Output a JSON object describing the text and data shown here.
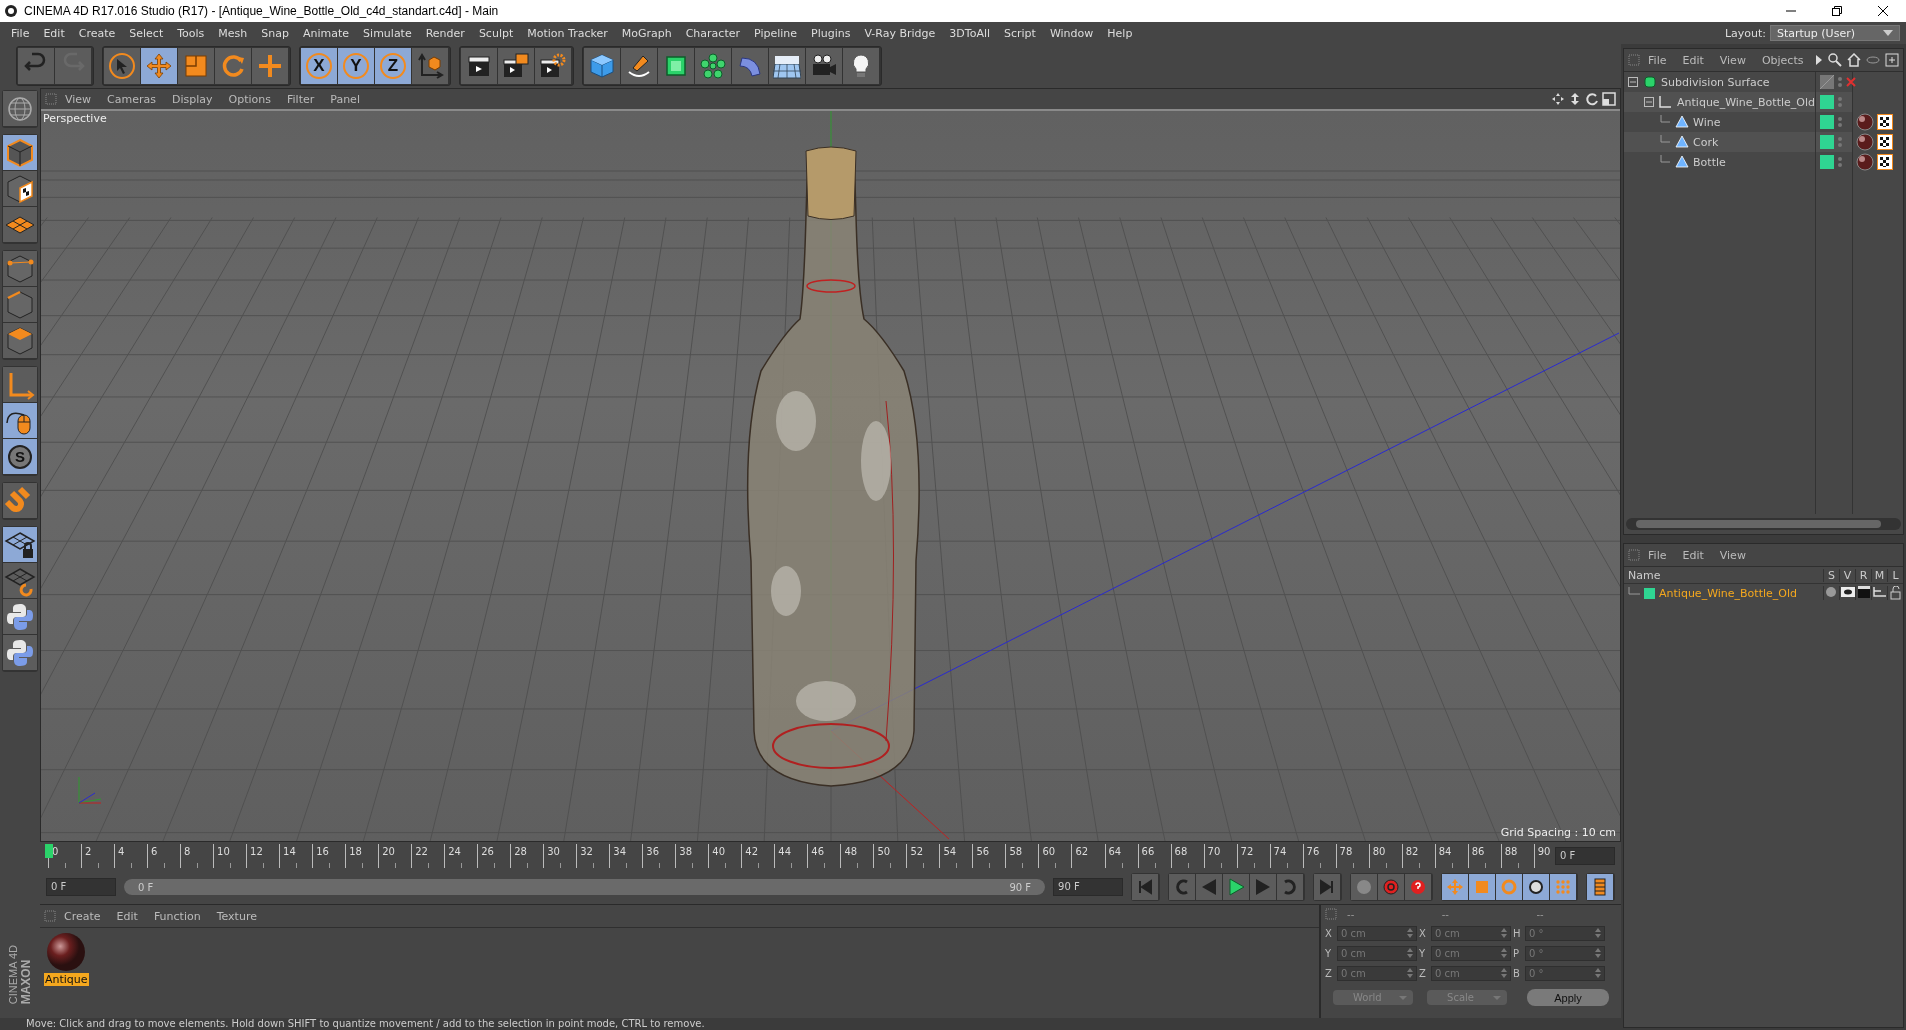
{
  "window": {
    "title": "CINEMA 4D R17.016 Studio (R17) - [Antique_Wine_Bottle_Old_c4d_standart.c4d] - Main"
  },
  "menu": [
    "File",
    "Edit",
    "Create",
    "Select",
    "Tools",
    "Mesh",
    "Snap",
    "Animate",
    "Simulate",
    "Render",
    "Sculpt",
    "Motion Tracker",
    "MoGraph",
    "Character",
    "Pipeline",
    "Plugins",
    "V-Ray Bridge",
    "3DToAll",
    "Script",
    "Window",
    "Help"
  ],
  "layout": {
    "label": "Layout:",
    "value": "Startup (User)"
  },
  "toolbar": [
    {
      "kind": "undo",
      "disabled": false
    },
    {
      "kind": "redo",
      "disabled": true
    },
    {
      "kind": "sep"
    },
    {
      "kind": "select",
      "selected": false
    },
    {
      "kind": "move",
      "selected": true
    },
    {
      "kind": "scale",
      "selected": false
    },
    {
      "kind": "rotate",
      "selected": false
    },
    {
      "kind": "add",
      "selected": false
    },
    {
      "kind": "sep"
    },
    {
      "kind": "axis",
      "label": "X",
      "selected": true
    },
    {
      "kind": "axis",
      "label": "Y",
      "selected": true
    },
    {
      "kind": "axis",
      "label": "Z",
      "selected": true
    },
    {
      "kind": "coords",
      "selected": false
    },
    {
      "kind": "sep"
    },
    {
      "kind": "render-view"
    },
    {
      "kind": "render-picture"
    },
    {
      "kind": "render-settings"
    },
    {
      "kind": "sep"
    },
    {
      "kind": "cube"
    },
    {
      "kind": "pen"
    },
    {
      "kind": "subdivision"
    },
    {
      "kind": "cloner"
    },
    {
      "kind": "deformer"
    },
    {
      "kind": "floor"
    },
    {
      "kind": "camera"
    },
    {
      "kind": "light"
    }
  ],
  "left_toolbar": [
    {
      "kind": "nav",
      "selected": false
    },
    {
      "kind": "sep"
    },
    {
      "kind": "model",
      "selected": true
    },
    {
      "kind": "texture",
      "selected": false
    },
    {
      "kind": "workplane",
      "selected": false
    },
    {
      "kind": "sep"
    },
    {
      "kind": "points",
      "selected": false
    },
    {
      "kind": "edges",
      "selected": false
    },
    {
      "kind": "polygons",
      "selected": false
    },
    {
      "kind": "sep"
    },
    {
      "kind": "axis",
      "selected": false
    },
    {
      "kind": "tweak",
      "selected": true
    },
    {
      "kind": "soft",
      "label": "S",
      "selected": true
    },
    {
      "kind": "sep"
    },
    {
      "kind": "magnet",
      "selected": false
    },
    {
      "kind": "sep"
    },
    {
      "kind": "lock-plane",
      "selected": true
    },
    {
      "kind": "plane-rotate",
      "selected": false
    },
    {
      "kind": "python",
      "selected": false
    },
    {
      "kind": "python",
      "selected": false
    }
  ],
  "brand": [
    "MAXON",
    "CINEMA 4D"
  ],
  "viewport": {
    "menu": [
      "View",
      "Cameras",
      "Display",
      "Options",
      "Filter",
      "Panel"
    ],
    "camera": "Perspective",
    "grid_spacing": "Grid Spacing : 10 cm"
  },
  "timeline": {
    "ticks": [
      "0",
      "2",
      "4",
      "6",
      "8",
      "10",
      "12",
      "14",
      "16",
      "18",
      "20",
      "22",
      "24",
      "26",
      "28",
      "30",
      "32",
      "34",
      "36",
      "38",
      "40",
      "42",
      "44",
      "46",
      "48",
      "50",
      "52",
      "54",
      "56",
      "58",
      "60",
      "62",
      "64",
      "66",
      "68",
      "70",
      "72",
      "74",
      "76",
      "78",
      "80",
      "82",
      "84",
      "86",
      "88",
      "90"
    ],
    "current_frame": "0 F",
    "start": "0 F",
    "range": {
      "start": "0 F",
      "end": "90 F",
      "level": 1
    },
    "end": "90 F"
  },
  "objects": {
    "menu": [
      "File",
      "Edit",
      "View",
      "Objects"
    ],
    "tree": [
      {
        "name": "Subdivision Surface",
        "kind": "subdivision",
        "expanded": true,
        "children": [
          {
            "name": "Antique_Wine_Bottle_Old",
            "kind": "null",
            "expanded": true,
            "children": [
              {
                "name": "Wine",
                "kind": "polygon"
              },
              {
                "name": "Cork",
                "kind": "polygon"
              },
              {
                "name": "Bottle",
                "kind": "polygon"
              }
            ]
          }
        ]
      }
    ]
  },
  "layers": {
    "menu": [
      "File",
      "Edit",
      "View"
    ],
    "columns": [
      "Name",
      "S",
      "V",
      "R",
      "M",
      "L"
    ],
    "rows": [
      {
        "name": "Antique_Wine_Bottle_Old",
        "color": "#2fd592"
      }
    ]
  },
  "materials": {
    "menu": [
      "Create",
      "Edit",
      "Function",
      "Texture"
    ],
    "items": [
      {
        "name": "Antique",
        "selected": true
      }
    ]
  },
  "coordinates": {
    "headers": [
      "--",
      "--",
      "--"
    ],
    "rows": [
      {
        "a": "X",
        "pos": "0 cm",
        "b": "X",
        "size": "0 cm",
        "c": "H",
        "rot": "0 °"
      },
      {
        "a": "Y",
        "pos": "0 cm",
        "b": "Y",
        "size": "0 cm",
        "c": "P",
        "rot": "0 °"
      },
      {
        "a": "Z",
        "pos": "0 cm",
        "b": "Z",
        "size": "0 cm",
        "c": "B",
        "rot": "0 °"
      }
    ],
    "mode": "World",
    "transform": "Scale",
    "apply": "Apply"
  },
  "status_bar": "Move: Click and drag to move elements. Hold down SHIFT to quantize movement / add to the selection in point mode, CTRL to remove."
}
